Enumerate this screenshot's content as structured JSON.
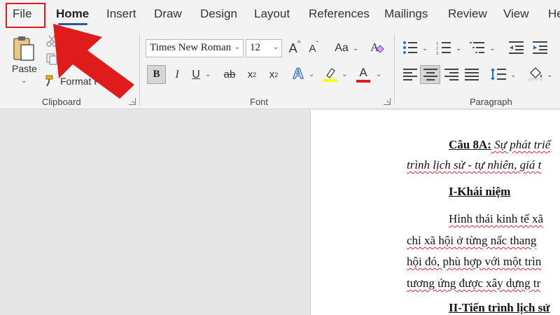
{
  "tabs": [
    {
      "label": "File"
    },
    {
      "label": "Home",
      "active": true
    },
    {
      "label": "Insert"
    },
    {
      "label": "Draw"
    },
    {
      "label": "Design"
    },
    {
      "label": "Layout"
    },
    {
      "label": "References"
    },
    {
      "label": "Mailings"
    },
    {
      "label": "Review"
    },
    {
      "label": "View"
    },
    {
      "label": "He"
    }
  ],
  "clipboard": {
    "paste_label": "Paste",
    "format_painter_label": "Format P",
    "group_label": "Clipboard"
  },
  "font": {
    "font_name": "Times New Roman",
    "font_size": "12",
    "change_case_label": "Aa",
    "grow_label": "A",
    "shrink_label": "A",
    "bold": "B",
    "italic": "I",
    "underline": "U",
    "strikethrough": "ab",
    "subscript": "x",
    "subscript_mark": "2",
    "superscript": "x",
    "superscript_mark": "2",
    "text_effects": "A",
    "font_color": "A",
    "group_label": "Font",
    "highlight_color": "#ffff00",
    "font_color_value": "#e01b1b"
  },
  "paragraph": {
    "group_label": "Paragraph"
  },
  "document": {
    "line1_heading": "Câu 8A:",
    "line1_rest": " Sự phát triể",
    "line2": "trình lịch sử - tự nhiên, giá t",
    "heading1": "I-Khái niệm",
    "para1": "Hình thái kinh tế xã",
    "para2": "chỉ xã hội ở từng nấc thang",
    "para3": "hội đó, phù hợp với một trìn",
    "para4": "tương ứng được xây dựng tr",
    "heading2": "II-Tiến trình lịch sử"
  },
  "colors": {
    "accent": "#2b579a",
    "annotation_red": "#e01b1b"
  }
}
